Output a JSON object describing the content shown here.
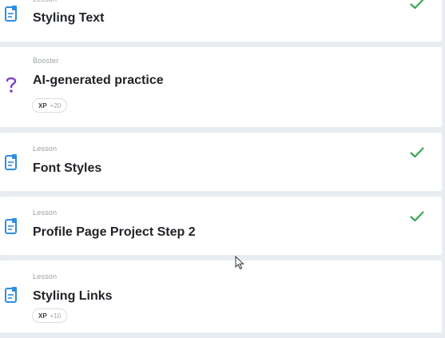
{
  "items": [
    {
      "kind": "Lesson",
      "title": "Styling Text",
      "icon": "lesson-doc-icon",
      "completed": true
    },
    {
      "kind": "Booster",
      "title": "AI-generated practice",
      "icon": "question-mark-icon",
      "completed": false,
      "xp": {
        "label": "XP",
        "value": "+20"
      }
    },
    {
      "kind": "Lesson",
      "title": "Font Styles",
      "icon": "lesson-doc-icon",
      "completed": true
    },
    {
      "kind": "Lesson",
      "title": "Profile Page Project Step 2",
      "icon": "lesson-doc-icon",
      "completed": true
    },
    {
      "kind": "Lesson",
      "title": "Styling Links",
      "icon": "lesson-doc-icon",
      "completed": false,
      "xp": {
        "label": "XP",
        "value": "+10"
      }
    }
  ],
  "colors": {
    "accent_blue": "#2f8ee0",
    "booster_purple": "#7b3fc4",
    "check_green": "#3aa655",
    "background": "#e9ecf0"
  }
}
